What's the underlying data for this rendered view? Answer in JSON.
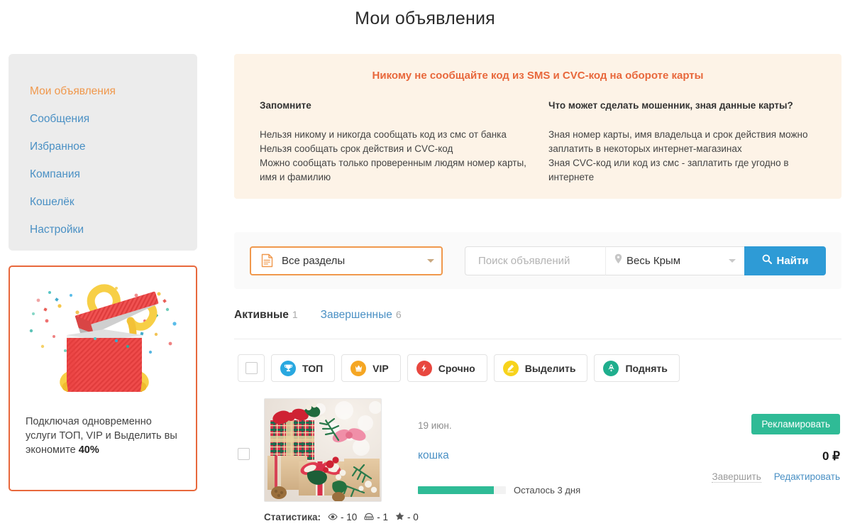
{
  "page": {
    "title": "Мои объявления"
  },
  "sidebar": {
    "items": [
      {
        "label": "Мои объявления",
        "active": true
      },
      {
        "label": "Сообщения",
        "active": false
      },
      {
        "label": "Избранное",
        "active": false
      },
      {
        "label": "Компания",
        "active": false
      },
      {
        "label": "Кошелёк",
        "active": false
      },
      {
        "label": "Настройки",
        "active": false
      }
    ]
  },
  "promo": {
    "text_before": "Подключая одновременно услуги ТОП, VIP и Выделить вы экономите ",
    "highlight": "40%",
    "border_color": "#e8683c"
  },
  "warning": {
    "title": "Никому не сообщайте код из SMS и CVC-код на обороте карты",
    "left_heading": "Запомните",
    "left_body": "Нельзя никому и никогда сообщать код из смс от банка\nНельзя сообщать срок действия и CVC-код\nМожно сообщать только проверенным людям номер карты, имя и фамилию",
    "right_heading": "Что может сделать мошенник, зная данные карты?",
    "right_body": "Зная номер карты, имя владельца и срок действия можно заплатить в некоторых интернет-магазинах\nЗная CVC-код или код из смс - заплатить где угодно в интернете",
    "accent_color": "#e8683c",
    "background_color": "#fdf3e7"
  },
  "search": {
    "category_value": "Все разделы",
    "query_value": "",
    "query_placeholder": "Поиск объявлений",
    "region_value": "Весь Крым",
    "find_label": "Найти",
    "find_color": "#2e9bd6"
  },
  "tabs": [
    {
      "label": "Активные",
      "count": "1",
      "active": true
    },
    {
      "label": "Завершенные",
      "count": "6",
      "active": false
    }
  ],
  "toolbar": {
    "select_all_checked": false,
    "actions": [
      {
        "label": "ТОП",
        "icon": "trophy-icon",
        "color": "#29a8e0"
      },
      {
        "label": "VIP",
        "icon": "crown-icon",
        "color": "#f5a623"
      },
      {
        "label": "Срочно",
        "icon": "lightning-icon",
        "color": "#e8473f"
      },
      {
        "label": "Выделить",
        "icon": "marker-icon",
        "color": "#f7d31c"
      },
      {
        "label": "Поднять",
        "icon": "rocket-icon",
        "color": "#1fae8d"
      }
    ]
  },
  "listing": {
    "checked": false,
    "date": "19 июн.",
    "title": "кошка",
    "progress_percent": 86,
    "progress_text": "Осталось 3 дня",
    "promote_label": "Рекламировать",
    "price": "0 ₽",
    "finish_label": "Завершить",
    "edit_label": "Редактировать",
    "stats_label": "Статистика:",
    "stats": [
      {
        "icon": "eye-icon",
        "value": "- 10"
      },
      {
        "icon": "phone-icon",
        "value": "- 1"
      },
      {
        "icon": "star-icon",
        "value": "- 0"
      }
    ],
    "thumbnail_alt": "christmas-gifts-photo"
  }
}
